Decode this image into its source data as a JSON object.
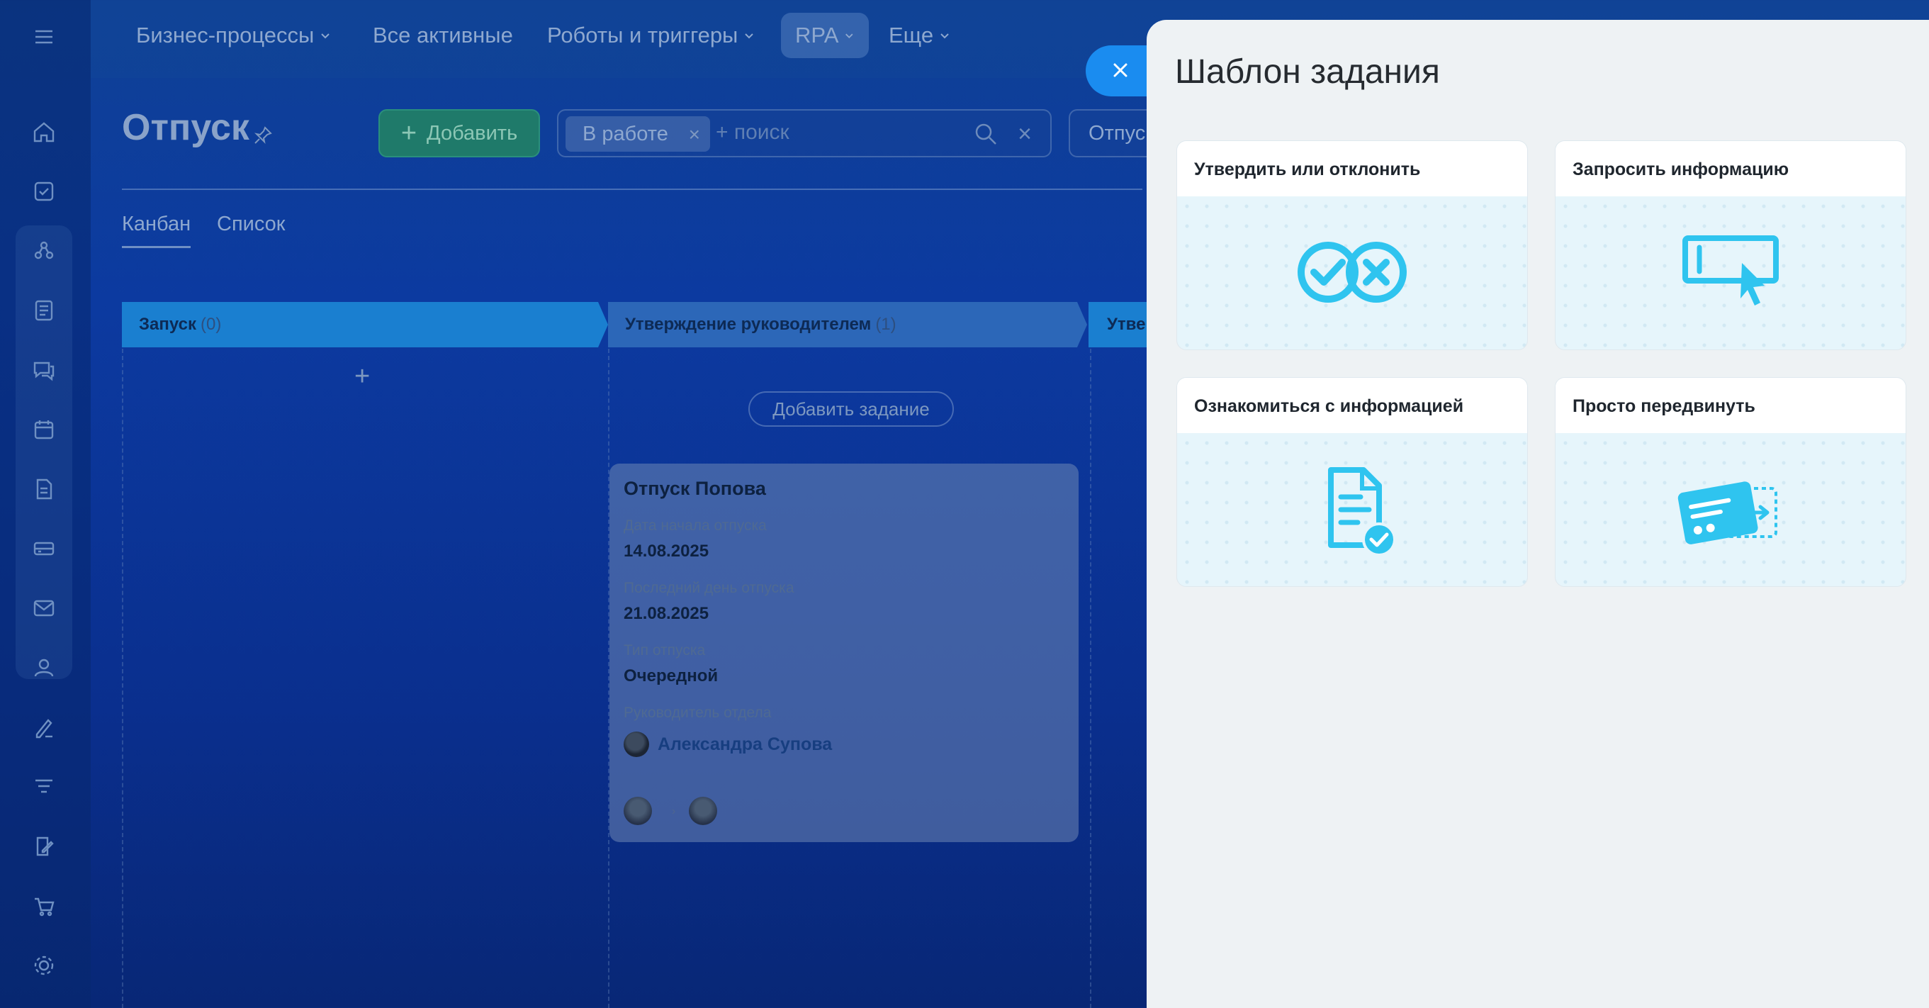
{
  "topnav": {
    "items": [
      {
        "label": "Бизнес-процессы",
        "has_dropdown": true
      },
      {
        "label": "Все активные",
        "has_dropdown": false
      },
      {
        "label": "Роботы и триггеры",
        "has_dropdown": true
      },
      {
        "label": "RPA",
        "has_dropdown": true,
        "active": true
      },
      {
        "label": "Еще",
        "has_dropdown": true
      }
    ]
  },
  "page": {
    "title": "Отпуск",
    "add_button": "Добавить",
    "filter_chip": "В работе",
    "search_placeholder": "+ поиск",
    "preset_button": "Отпуск",
    "tabs": [
      "Канбан",
      "Список"
    ]
  },
  "kanban": {
    "columns": [
      {
        "title": "Запуск",
        "count": "(0)",
        "color": "#1a7fd0"
      },
      {
        "title": "Утверждение руководителем",
        "count": "(1)",
        "color": "#2c67b8"
      },
      {
        "title": "Утве",
        "count": "",
        "color": "#1a7fd0"
      }
    ],
    "add_task_button": "Добавить задание",
    "card": {
      "title": "Отпуск Попова",
      "fields": [
        {
          "label": "Дата начала отпуска",
          "value": "14.08.2025"
        },
        {
          "label": "Последний день отпуска",
          "value": "21.08.2025"
        },
        {
          "label": "Тип отпуска",
          "value": "Очередной"
        }
      ],
      "manager_label": "Руководитель отдела",
      "manager_name": "Александра Супова"
    }
  },
  "panel": {
    "title": "Шаблон задания",
    "templates": [
      {
        "title": "Утвердить или отклонить",
        "icon": "approve-reject-icon"
      },
      {
        "title": "Запросить информацию",
        "icon": "request-info-icon"
      },
      {
        "title": "Ознакомиться с информацией",
        "icon": "read-document-icon"
      },
      {
        "title": "Просто передвинуть",
        "icon": "move-card-icon"
      }
    ],
    "accent": "#2fc4ef"
  }
}
